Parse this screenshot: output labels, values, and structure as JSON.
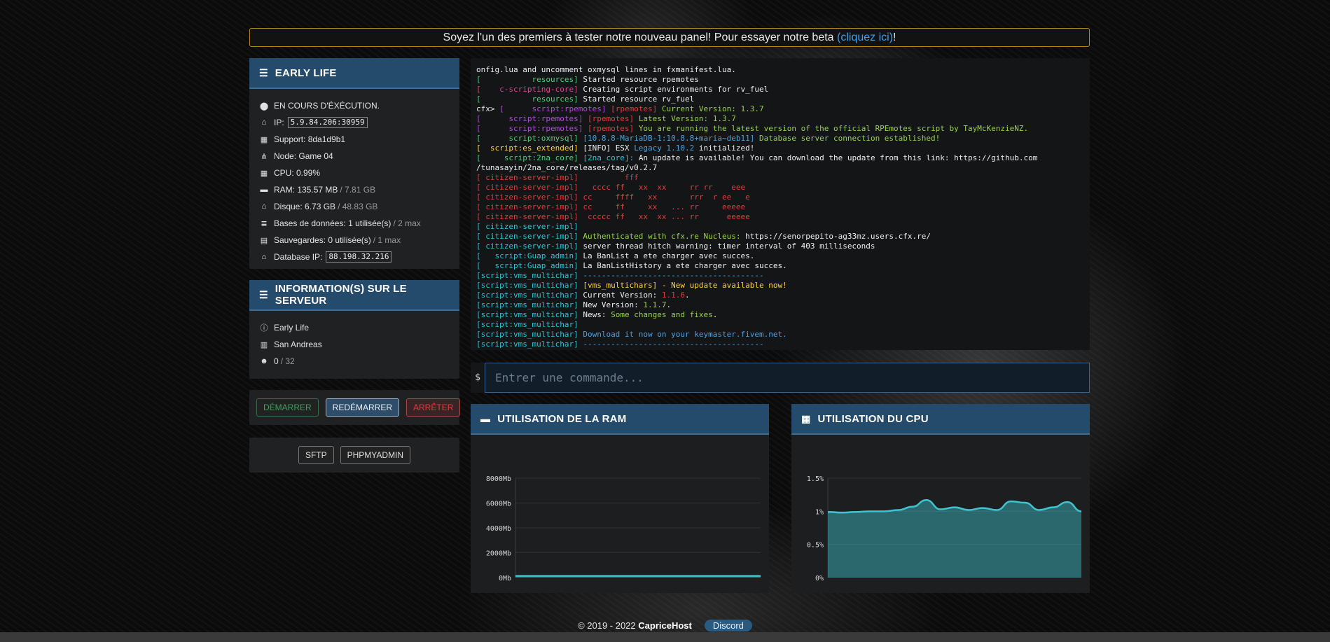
{
  "banner": {
    "text": "Soyez l'un des premiers à tester notre nouveau panel! Pour essayer notre beta ",
    "link": "(cliquez ici)",
    "end": "!"
  },
  "server_card": {
    "title": "EARLY LIFE",
    "status": "EN COURS D'ÉXÉCUTION.",
    "ip_label": "IP:",
    "ip_value": "5.9.84.206:30959",
    "support": "Support: 8da1d9b1",
    "node": "Node: Game 04",
    "cpu": "CPU: 0.99%",
    "ram_label": "RAM: 135.57 MB",
    "ram_max": "/ 7.81 GB",
    "disk_label": "Disque:",
    "disk_value": "6.73 GB",
    "disk_max": "/ 48.83 GB",
    "db_label": "Bases de données: 1 utilisée(s)",
    "db_max": "/ 2 max",
    "backup_label": "Sauvegardes: 0 utilisée(s)",
    "backup_max": "/ 1 max",
    "dbip_label": "Database IP:",
    "dbip_value": "88.198.32.216"
  },
  "info_card": {
    "title": "INFORMATION(S) SUR LE SERVEUR",
    "name": "Early Life",
    "map": "San Andreas",
    "players": "0",
    "players_max": "/ 32"
  },
  "actions": {
    "start": "DÉMARRER",
    "restart": "REDÉMARRER",
    "stop": "ARRÊTER",
    "sftp": "SFTP",
    "phpmyadmin": "PHPMYADMIN"
  },
  "console_lines": [
    [
      [
        "onfig.lua and uncomment oxmysql lines in fxmanifest.lua.",
        "w"
      ]
    ],
    [
      [
        "[           resources] ",
        "g"
      ],
      [
        "Started resource rpemotes",
        "w"
      ]
    ],
    [
      [
        "[    c-scripting-core] ",
        "m"
      ],
      [
        "Creating script environments for rv_fuel",
        "w"
      ]
    ],
    [
      [
        "[           resources] ",
        "g"
      ],
      [
        "Started resource rv_fuel",
        "w"
      ]
    ],
    [
      [
        "cfx> ",
        "w"
      ],
      [
        "[      script:rpemotes] ",
        "p"
      ],
      [
        "[rpemotes] ",
        "e"
      ],
      [
        "Current Version: 1.3.7",
        "gy"
      ]
    ],
    [
      [
        "[      script:rpemotes] ",
        "p"
      ],
      [
        "[rpemotes] ",
        "e"
      ],
      [
        "Latest Version: 1.3.7",
        "gy"
      ]
    ],
    [
      [
        "[      script:rpemotes] ",
        "p"
      ],
      [
        "[rpemotes] ",
        "e"
      ],
      [
        "You are running the latest version of the official RPEmotes script by TayMcKenzieNZ.",
        "gy"
      ]
    ],
    [
      [
        "[      script:oxmysql] ",
        "g"
      ],
      [
        "[10.8.8-MariaDB-1:10.8.8+maria~deb11] ",
        "b"
      ],
      [
        "Database server connection established!",
        "gy"
      ]
    ],
    [
      [
        "[  script:es_extended] ",
        "y"
      ],
      [
        "[INFO] ",
        "w"
      ],
      [
        "ESX ",
        "w"
      ],
      [
        "Legacy 1.10.2 ",
        "b"
      ],
      [
        "initialized!",
        "w"
      ]
    ],
    [
      [
        "[     script:2na_core] ",
        "g"
      ],
      [
        "[2na_core]: ",
        "c"
      ],
      [
        "An update is available! You can download the update from this link: https://github.com",
        "w"
      ]
    ],
    [
      [
        "/tunasayin/2na_core/releases/tag/v0.2.7",
        "w"
      ]
    ],
    [
      [
        "[ citizen-server-impl]          fff",
        "e"
      ]
    ],
    [
      [
        "[ citizen-server-impl]   cccc ff   xx  xx     rr rr    eee",
        "e"
      ]
    ],
    [
      [
        "[ citizen-server-impl] cc     ffff   xx       rrr  r ee   e",
        "e"
      ]
    ],
    [
      [
        "[ citizen-server-impl] cc     ff     xx   ... rr     eeeee",
        "e"
      ]
    ],
    [
      [
        "[ citizen-server-impl]  ccccc ff   xx  xx ... rr      eeeee",
        "e"
      ]
    ],
    [
      [
        "[ citizen-server-impl]",
        "c"
      ]
    ],
    [
      [
        "[ citizen-server-impl] ",
        "c"
      ],
      [
        "Authenticated with cfx.re Nucleus: ",
        "gy"
      ],
      [
        "https://senorpepito-ag33mz.users.cfx.re/",
        "w"
      ]
    ],
    [
      [
        "[ citizen-server-impl] ",
        "c"
      ],
      [
        "server thread hitch warning: timer interval of 403 milliseconds",
        "w"
      ]
    ],
    [
      [
        "[   script:Guap_admin] ",
        "c"
      ],
      [
        "La BanList a ete charger avec succes.",
        "w"
      ]
    ],
    [
      [
        "[   script:Guap_admin] ",
        "c"
      ],
      [
        "La BanListHistory a ete charger avec succes.",
        "w"
      ]
    ],
    [
      [
        "[script:vms_multichar] ",
        "c"
      ],
      [
        "---------------------------------------",
        "b"
      ]
    ],
    [
      [
        "[script:vms_multichar] ",
        "c"
      ],
      [
        "[vms_multichars] - New update available now!",
        "y"
      ]
    ],
    [
      [
        "[script:vms_multichar] ",
        "c"
      ],
      [
        "Current Version: ",
        "w"
      ],
      [
        "1.1.6",
        "e"
      ],
      [
        ".",
        "w"
      ]
    ],
    [
      [
        "[script:vms_multichar] ",
        "c"
      ],
      [
        "New Version: ",
        "w"
      ],
      [
        "1.1.7",
        "gy"
      ],
      [
        ".",
        "w"
      ]
    ],
    [
      [
        "[script:vms_multichar] ",
        "c"
      ],
      [
        "News: ",
        "w"
      ],
      [
        "Some changes and fixes",
        "gy"
      ],
      [
        ".",
        "w"
      ]
    ],
    [
      [
        "[script:vms_multichar]",
        "c"
      ]
    ],
    [
      [
        "[script:vms_multichar] ",
        "c"
      ],
      [
        "Download it now on your keymaster.fivem.net.",
        "b"
      ]
    ],
    [
      [
        "[script:vms_multichar] ",
        "c"
      ],
      [
        "---------------------------------------",
        "b"
      ]
    ]
  ],
  "command": {
    "prompt": "$",
    "placeholder": "Entrer une commande..."
  },
  "ram_chart": {
    "title": "UTILISATION DE LA RAM",
    "chart_data": {
      "type": "area",
      "ylabel_ticks": [
        "8000Mb",
        "6000Mb",
        "4000Mb",
        "2000Mb",
        "0Mb"
      ],
      "ylim": [
        0,
        8000
      ],
      "values": [
        136,
        136,
        136,
        136,
        136,
        136,
        136,
        136,
        136,
        136,
        136,
        136,
        136,
        136,
        136,
        136,
        136,
        136,
        136,
        136,
        136,
        136,
        136,
        136,
        136,
        136,
        136,
        136,
        136,
        136
      ],
      "color": "#3fc4cf"
    }
  },
  "cpu_chart": {
    "title": "UTILISATION DU CPU",
    "chart_data": {
      "type": "area",
      "ylabel_ticks": [
        "1.5%",
        "1%",
        "0.5%",
        "0%"
      ],
      "ylim": [
        0,
        1.5
      ],
      "values": [
        0.99,
        0.98,
        0.99,
        1.0,
        1.0,
        1.02,
        1.07,
        1.17,
        1.03,
        1.06,
        1.02,
        1.05,
        1.02,
        1.15,
        1.13,
        1.02,
        1.06,
        1.14,
        1.0
      ],
      "color": "#3fc4cf"
    }
  },
  "footer": {
    "copyright": "© 2019 - 2022 ",
    "brand": "CapriceHost",
    "discord": "Discord"
  }
}
